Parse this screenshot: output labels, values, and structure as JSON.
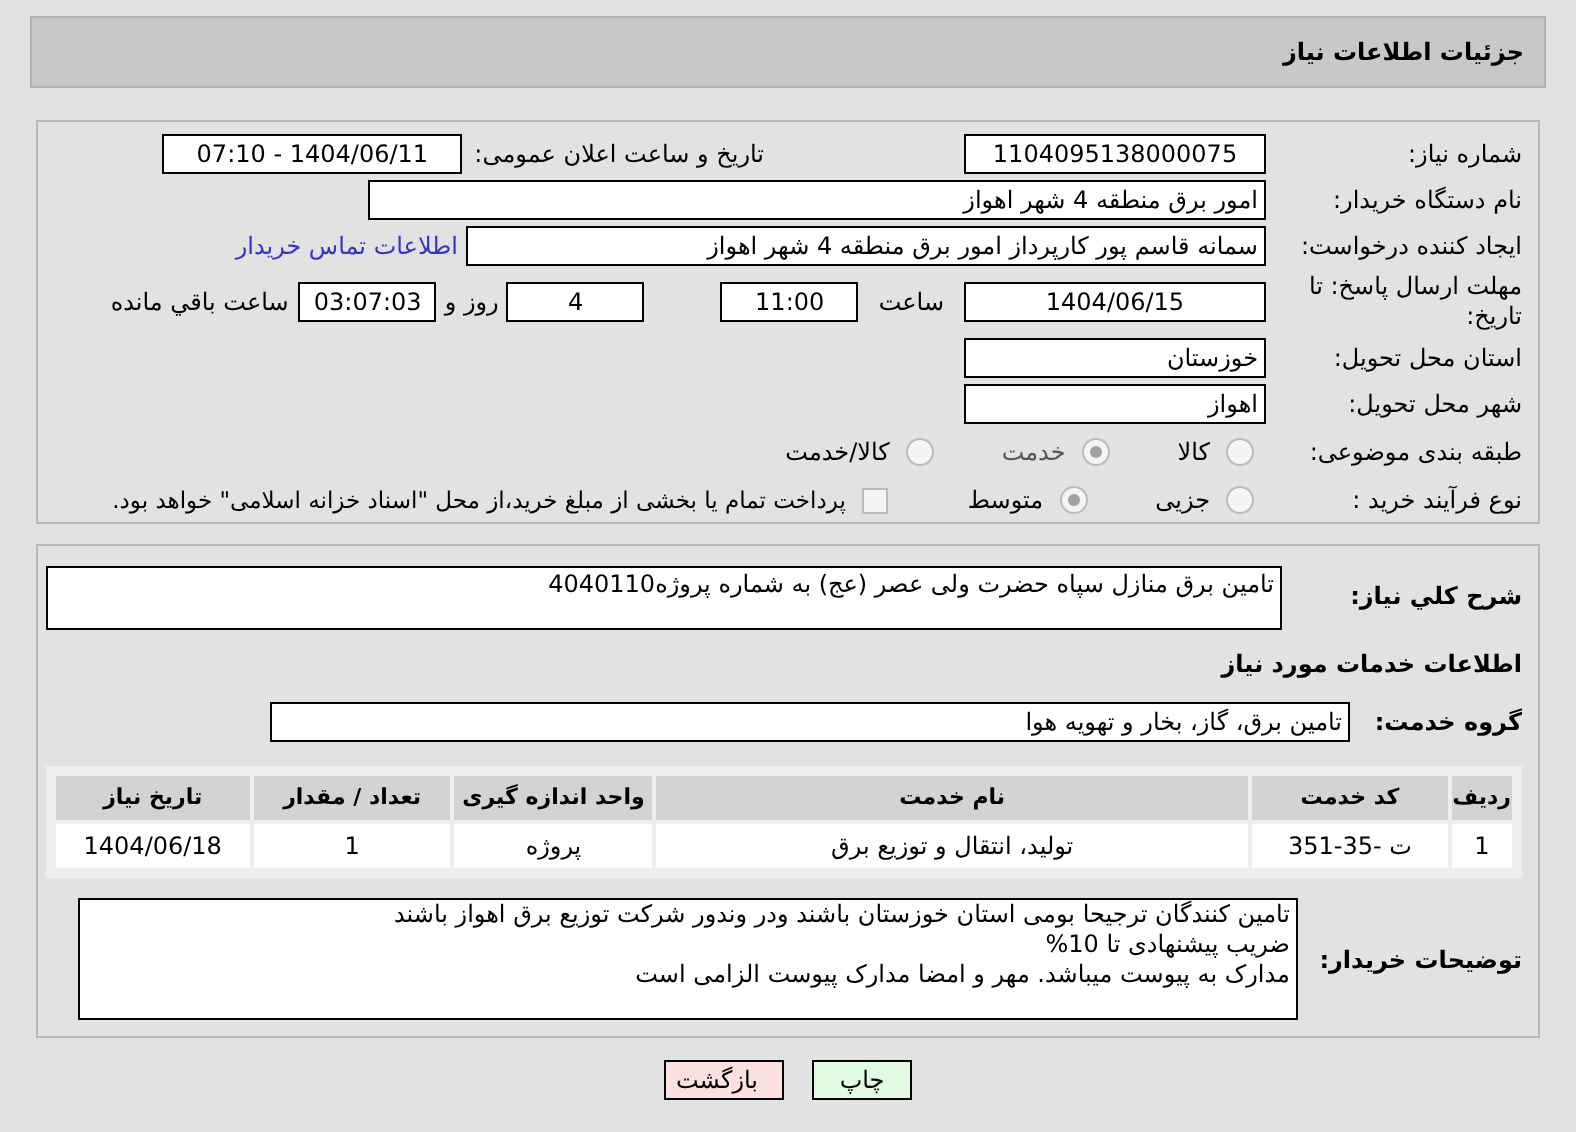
{
  "header": {
    "title": "جزئیات اطلاعات نیاز"
  },
  "details": {
    "need_number": {
      "label": "شماره نیاز:",
      "value": "1104095138000075"
    },
    "announce": {
      "label": "تاریخ و ساعت اعلان عمومی:",
      "value": "1404/06/11 - 07:10"
    },
    "buyer": {
      "label": "نام دستگاه خریدار:",
      "value": "امور برق منطقه 4 شهر اهواز"
    },
    "creator": {
      "label": "ایجاد کننده درخواست:",
      "value": "سمانه قاسم پور کارپرداز امور برق منطقه 4 شهر اهواز",
      "link": "اطلاعات تماس خریدار"
    },
    "deadline": {
      "label": "مهلت ارسال پاسخ: تا تاریخ:",
      "date": "1404/06/15",
      "time_label": "ساعت",
      "time": "11:00",
      "days": "4",
      "days_label": "روز و",
      "remaining": "03:07:03",
      "remaining_label": "ساعت باقي مانده"
    },
    "province": {
      "label": "استان محل تحویل:",
      "value": "خوزستان"
    },
    "city": {
      "label": "شهر محل تحویل:",
      "value": "اهواز"
    },
    "category": {
      "label": "طبقه بندی موضوعی:",
      "options": [
        {
          "label": "کالا",
          "selected": false
        },
        {
          "label": "خدمت",
          "selected": true
        },
        {
          "label": "کالا/خدمت",
          "selected": false
        }
      ]
    },
    "purchase_type": {
      "label": "نوع فرآیند خرید :",
      "options": [
        {
          "label": "جزیی",
          "selected": false
        },
        {
          "label": "متوسط",
          "selected": true
        }
      ],
      "payment": {
        "checked": false,
        "label": "پرداخت تمام یا بخشی از مبلغ خرید،از محل \"اسناد خزانه اسلامی\" خواهد بود."
      }
    }
  },
  "description": {
    "label": "شرح کلي نیاز:",
    "value": "تامین برق منازل سپاه حضرت ولی عصر (عج) به شماره پروژه4040110"
  },
  "services_heading": "اطلاعات خدمات مورد نیاز",
  "service_group": {
    "label": "گروه خدمت:",
    "value": "تامین برق، گاز، بخار و تهویه هوا"
  },
  "table": {
    "columns": [
      "ردیف",
      "کد خدمت",
      "نام خدمت",
      "واحد اندازه گیری",
      "تعداد / مقدار",
      "تاریخ نیاز"
    ],
    "rows": [
      [
        "1",
        "ت -35-351",
        "تولید، انتقال و توزیع برق",
        "پروژه",
        "1",
        "1404/06/18"
      ]
    ]
  },
  "buyer_notes": {
    "label": "توضیحات خریدار:",
    "lines": [
      "تامین کنندگان ترجیحا بومی استان خوزستان باشند ودر وندور شرکت توزیع برق اهواز باشند",
      "ضریب پیشنهادی تا 10%",
      "مدارک به پیوست میباشد. مهر و امضا مدارک پیوست الزامی است"
    ]
  },
  "buttons": [
    {
      "label": "چاپ",
      "kind": "print"
    },
    {
      "label": "بازگشت",
      "kind": "back"
    }
  ]
}
